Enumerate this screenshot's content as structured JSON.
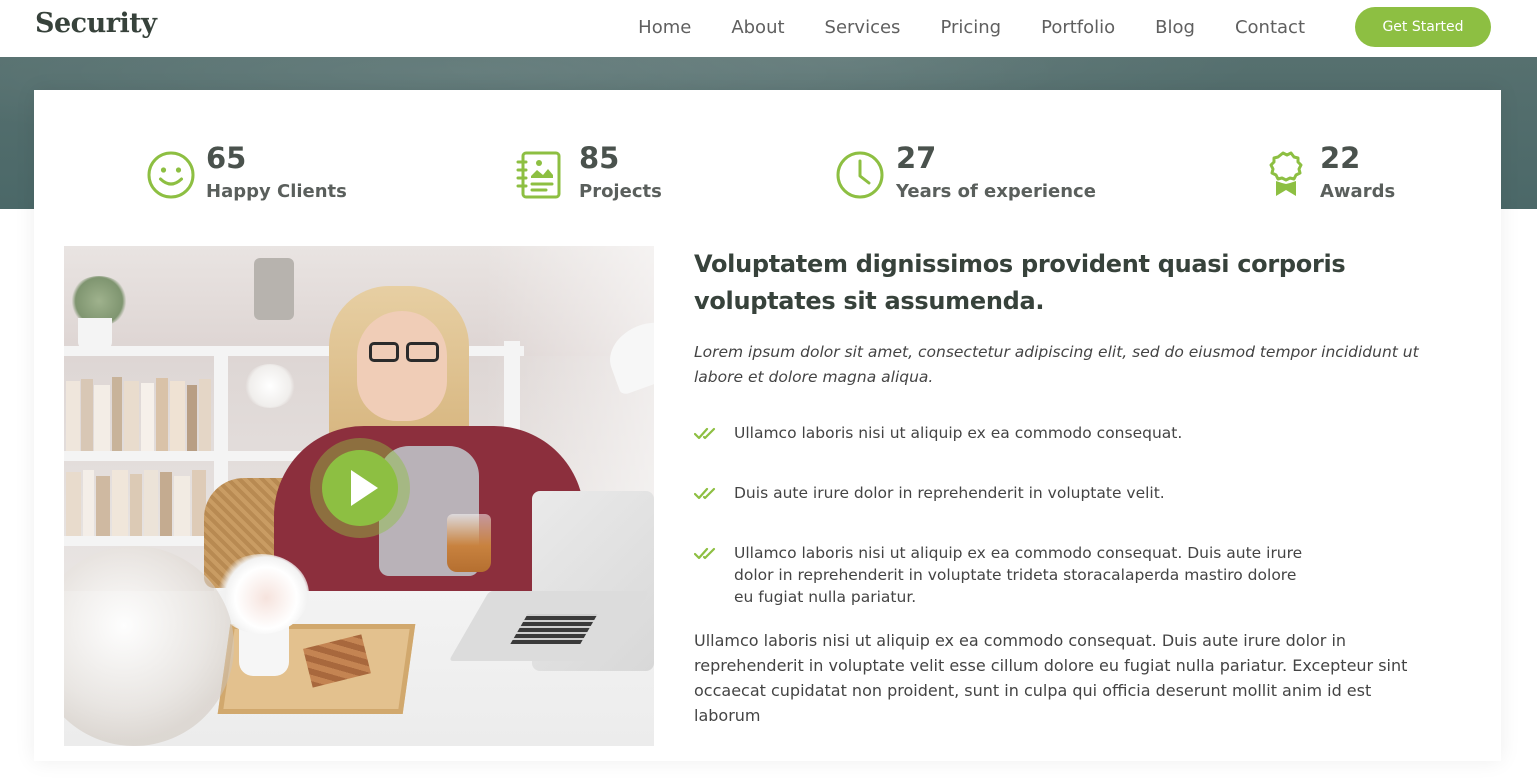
{
  "header": {
    "logo": "Security",
    "nav": [
      {
        "label": "Home"
      },
      {
        "label": "About"
      },
      {
        "label": "Services"
      },
      {
        "label": "Pricing"
      },
      {
        "label": "Portfolio"
      },
      {
        "label": "Blog"
      },
      {
        "label": "Contact"
      }
    ],
    "cta_label": "Get Started"
  },
  "colors": {
    "accent": "#8dbf42",
    "heading": "#37423b",
    "hero_band": "#4f6b6b"
  },
  "stats": [
    {
      "value": "65",
      "label": "Happy Clients",
      "icon": "smile-icon"
    },
    {
      "value": "85",
      "label": "Projects",
      "icon": "journal-richtext-icon"
    },
    {
      "value": "27",
      "label": "Years of experience",
      "icon": "clock-icon"
    },
    {
      "value": "22",
      "label": "Awards",
      "icon": "award-icon"
    }
  ],
  "about": {
    "title": "Voluptatem dignissimos provident quasi corporis voluptates sit assumenda.",
    "lead": "Lorem ipsum dolor sit amet, consectetur adipiscing elit, sed do eiusmod tempor incididunt ut labore et dolore magna aliqua.",
    "checks": [
      {
        "text": "Ullamco laboris nisi ut aliquip ex ea commodo consequat.",
        "icon": "double-check-icon"
      },
      {
        "text": "Duis aute irure dolor in reprehenderit in voluptate velit.",
        "icon": "double-check-icon"
      },
      {
        "text": "Ullamco laboris nisi ut aliquip ex ea commodo consequat. Duis aute irure dolor in reprehenderit in voluptate trideta storacalaperda mastiro dolore eu fugiat nulla pariatur.",
        "icon": "double-check-icon"
      }
    ],
    "paragraph": "Ullamco laboris nisi ut aliquip ex ea commodo consequat. Duis aute irure dolor in reprehenderit in voluptate velit esse cillum dolore eu fugiat nulla pariatur. Excepteur sint occaecat cupidatat non proident, sunt in culpa qui officia deserunt mollit anim id est laborum",
    "video_icon": "play-icon"
  }
}
